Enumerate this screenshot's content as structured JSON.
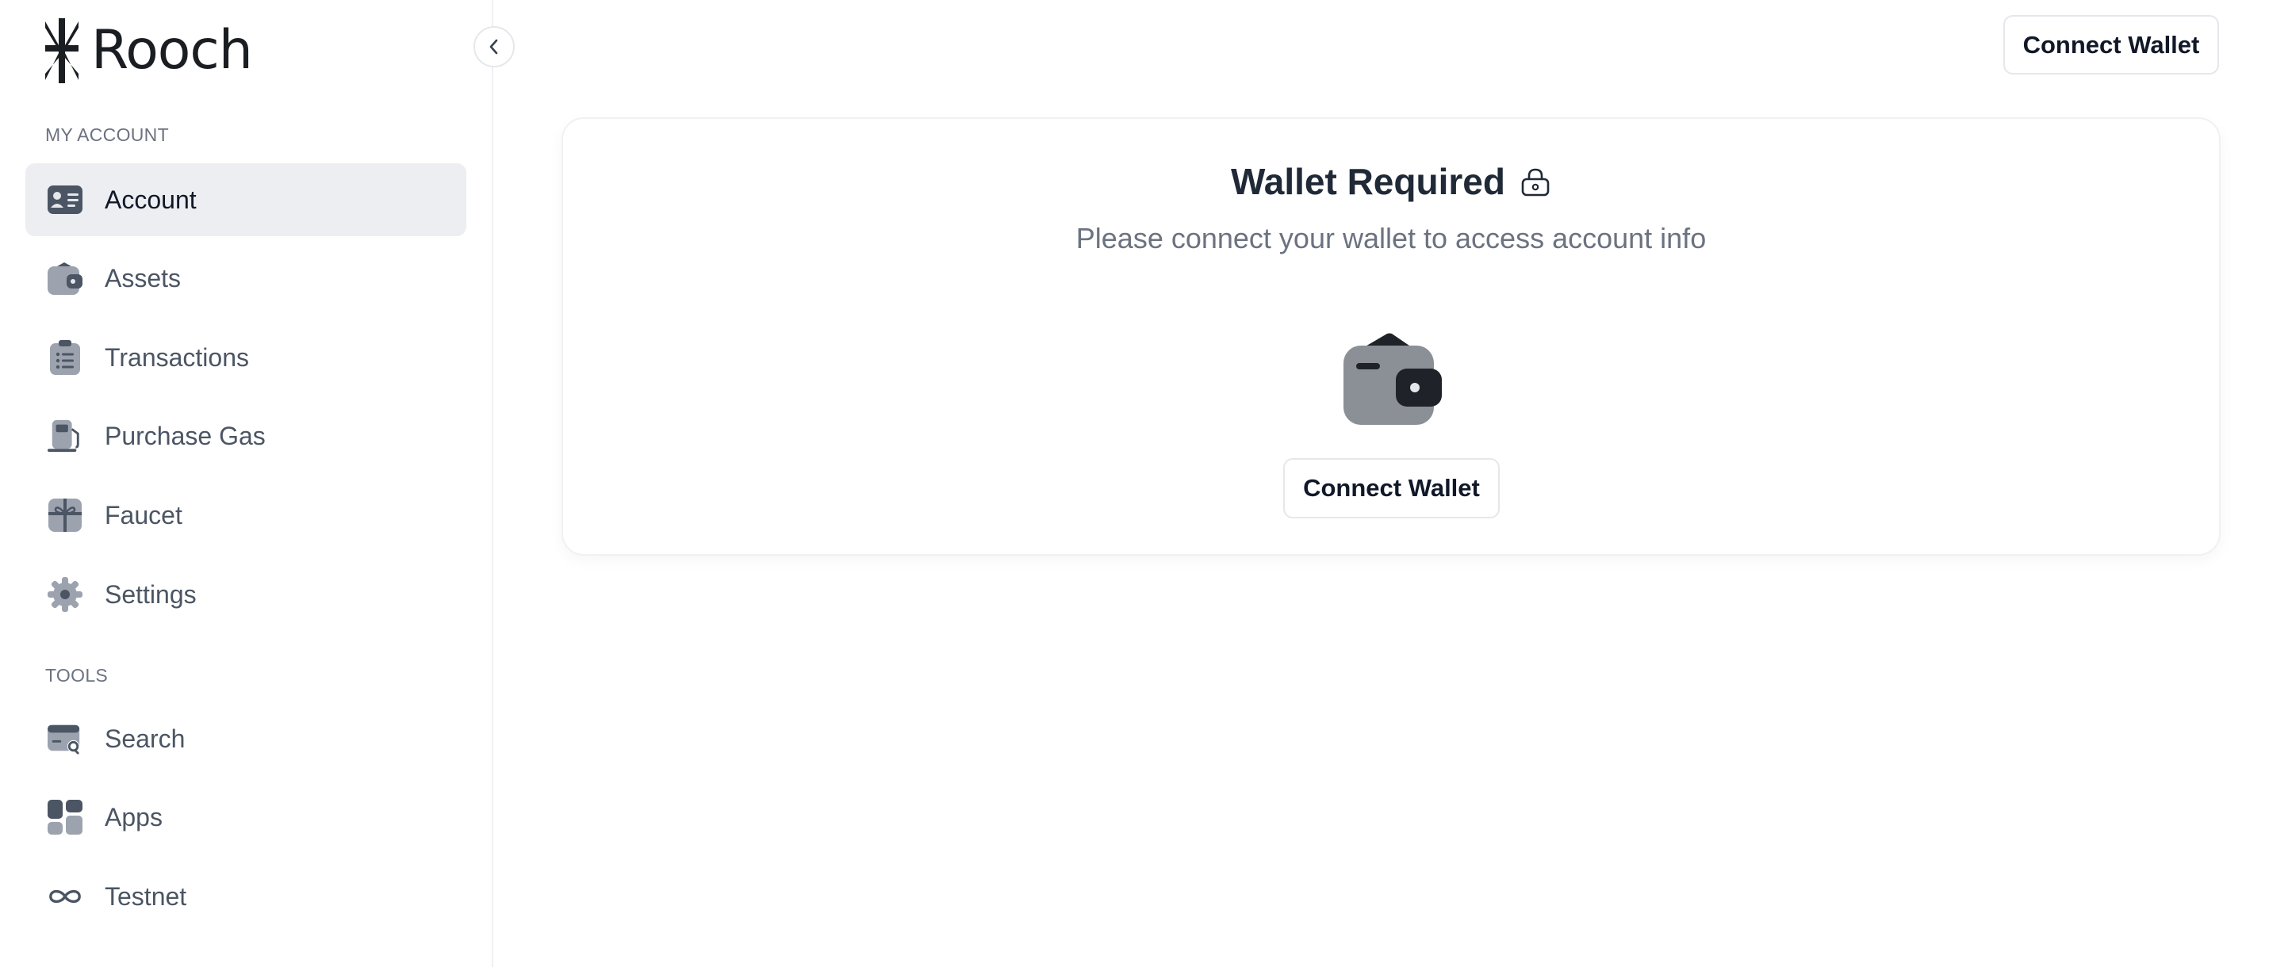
{
  "app": {
    "name": "Rooch"
  },
  "header": {
    "connect_label": "Connect Wallet"
  },
  "sidebar": {
    "sections": [
      {
        "title": "MY ACCOUNT",
        "items": [
          {
            "label": "Account",
            "icon": "account-card-icon",
            "active": true
          },
          {
            "label": "Assets",
            "icon": "wallet-icon",
            "active": false
          },
          {
            "label": "Transactions",
            "icon": "clipboard-list-icon",
            "active": false
          },
          {
            "label": "Purchase Gas",
            "icon": "gas-pump-icon",
            "active": false
          },
          {
            "label": "Faucet",
            "icon": "gift-icon",
            "active": false
          },
          {
            "label": "Settings",
            "icon": "gear-icon",
            "active": false
          }
        ]
      },
      {
        "title": "TOOLS",
        "items": [
          {
            "label": "Search",
            "icon": "search-card-icon",
            "active": false
          },
          {
            "label": "Apps",
            "icon": "apps-grid-icon",
            "active": false
          },
          {
            "label": "Testnet",
            "icon": "infinity-icon",
            "active": false
          }
        ]
      }
    ]
  },
  "main": {
    "card": {
      "title": "Wallet Required",
      "subtitle": "Please connect your wallet to access account info",
      "connect_label": "Connect Wallet",
      "icons": [
        "lock-icon",
        "wallet-illustration-icon"
      ]
    }
  },
  "colors": {
    "active_bg": "#eceef1",
    "text_primary": "#111827",
    "text_secondary": "#6b7280",
    "icon_gray": "#8b9096",
    "icon_dark": "#1f2329"
  }
}
